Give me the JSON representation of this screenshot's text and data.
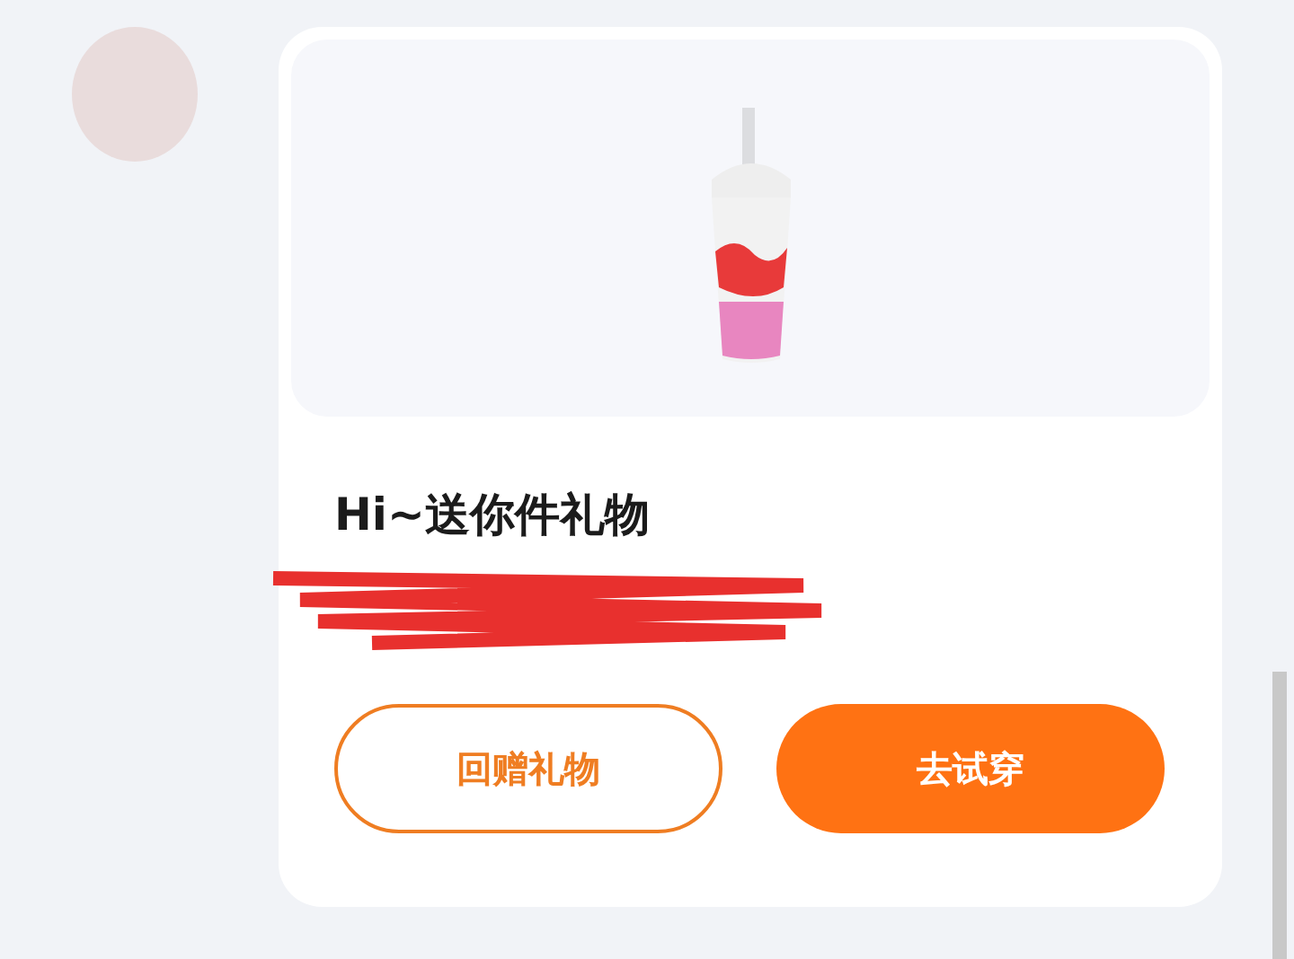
{
  "message": {
    "title": "Hi~送你件礼物",
    "buttons": [
      {
        "label": "回赠礼物",
        "kind": "outline"
      },
      {
        "label": "去试穿",
        "kind": "filled"
      }
    ]
  }
}
